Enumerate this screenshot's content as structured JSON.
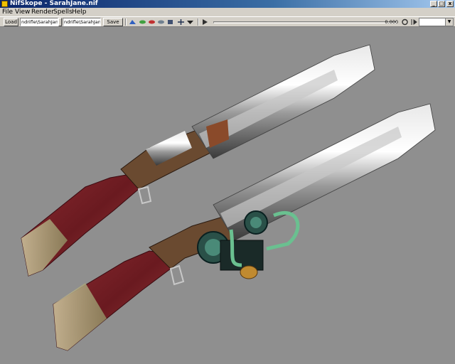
{
  "window": {
    "title": "NifSkope - SarahJane.nif"
  },
  "menu": {
    "items": [
      "File",
      "View",
      "Render",
      "Spells",
      "Help"
    ]
  },
  "toolbar": {
    "load_label": "Load",
    "load_path": "ndrifle\\SarahJane.nif",
    "save_path": "ndrifle\\SarahJane.nif",
    "save_as_label": "Save As",
    "time_value": "0.000",
    "icons": [
      "view-mode-icon",
      "eye-icon",
      "animate-icon",
      "zoom-icon",
      "lighting-icon",
      "texture-icon",
      "axis-icon",
      "dropdown-arrow-icon",
      "play-icon",
      "loop-icon",
      "switch-icon"
    ]
  },
  "viewport": {
    "background": "#8f8f8f",
    "models": [
      "rifle-upper",
      "rifle-lower"
    ]
  }
}
